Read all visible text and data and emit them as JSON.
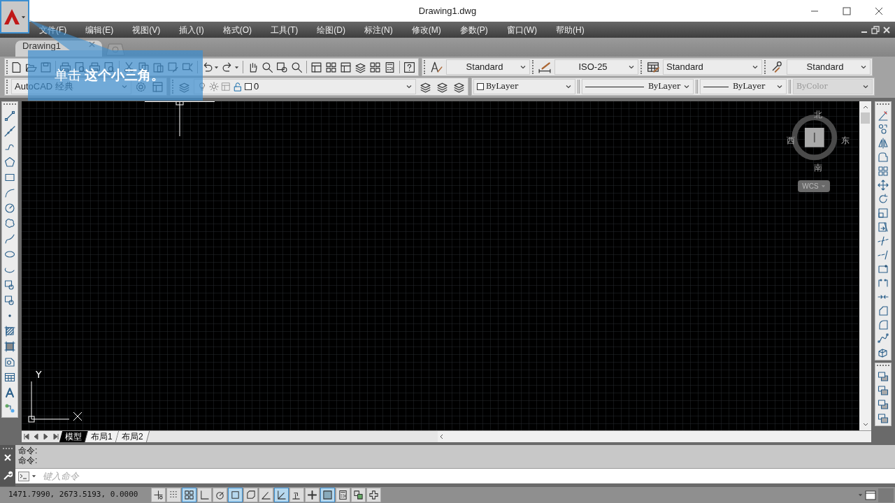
{
  "window": {
    "title": "Drawing1.dwg"
  },
  "menu": [
    "文件(F)",
    "编辑(E)",
    "视图(V)",
    "插入(I)",
    "格式(O)",
    "工具(T)",
    "绘图(D)",
    "标注(N)",
    "修改(M)",
    "参数(P)",
    "窗口(W)",
    "帮助(H)"
  ],
  "document_tabs": [
    {
      "label": "Drawing1",
      "selected": true
    }
  ],
  "style_toolbar": [
    {
      "kind": "text_style",
      "value": "Standard"
    },
    {
      "kind": "dim_style",
      "value": "ISO-25"
    },
    {
      "kind": "table_style",
      "value": "Standard"
    },
    {
      "kind": "multileader_style",
      "value": "Standard"
    }
  ],
  "workspace": {
    "value": "AutoCAD 经典"
  },
  "layer": {
    "value": "0"
  },
  "properties": [
    {
      "kind": "color",
      "value": "ByLayer",
      "disabled": false
    },
    {
      "kind": "linetype",
      "value": "ByLayer",
      "disabled": false
    },
    {
      "kind": "lineweight",
      "value": "ByLayer",
      "disabled": false
    },
    {
      "kind": "plot_style",
      "value": "ByColor",
      "disabled": true
    }
  ],
  "viewcube": {
    "north": "北",
    "west": "西",
    "east": "东",
    "south": "南",
    "ucs": "WCS"
  },
  "ucs_icon": {
    "y_label": "Y"
  },
  "layout_tabs": [
    {
      "label": "模型",
      "selected": true
    },
    {
      "label": "布局1",
      "selected": false
    },
    {
      "label": "布局2",
      "selected": false
    }
  ],
  "command_history": [
    "命令:",
    "命令:"
  ],
  "command_input": {
    "placeholder": "键入命令"
  },
  "status_bar": {
    "coordinates": "1471.7990, 2673.5193, 0.0000",
    "toggles": [
      {
        "on": false
      },
      {
        "on": false
      },
      {
        "on": true
      },
      {
        "on": false
      },
      {
        "on": false
      },
      {
        "on": true
      },
      {
        "on": false
      },
      {
        "on": false
      },
      {
        "on": true
      },
      {
        "on": false
      },
      {
        "on": false
      },
      {
        "on": true
      },
      {
        "on": false
      },
      {
        "on": false
      },
      {
        "on": false
      }
    ]
  },
  "callout": {
    "text": "单击 **这个小三角。**"
  }
}
